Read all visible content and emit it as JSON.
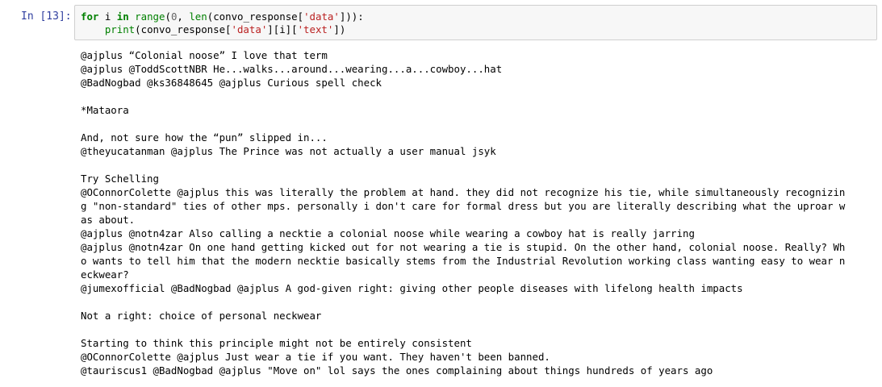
{
  "cell": {
    "prompt": "In [13]:",
    "code_line1": {
      "kw_for": "for",
      "var_i": " i ",
      "kw_in": "in",
      "sp": " ",
      "fn_range": "range",
      "p1": "(",
      "num0": "0",
      "p2": ", ",
      "fn_len": "len",
      "p3": "(convo_response[",
      "str_data": "'data'",
      "p4": "])):"
    },
    "code_line2": {
      "indent": "    ",
      "fn_print": "print",
      "p1": "(convo_response[",
      "str_data": "'data'",
      "p2": "][i][",
      "str_text": "'text'",
      "p3": "])"
    },
    "output_lines": [
      "@ajplus “Colonial noose” I love that term",
      "@ajplus @ToddScottNBR He...walks...around...wearing...a...cowboy...hat",
      "@BadNogbad @ks36848645 @ajplus Curious spell check",
      "",
      "*Mataora",
      "",
      "And, not sure how the “pun” slipped in...",
      "@theyucatanman @ajplus The Prince was not actually a user manual jsyk",
      "",
      "Try Schelling",
      "@OConnorColette @ajplus this was literally the problem at hand. they did not recognize his tie, while simultaneously recognizin",
      "g \"non-standard\" ties of other mps. personally i don't care for formal dress but you are literally describing what the uproar w",
      "as about.",
      "@ajplus @notn4zar Also calling a necktie a colonial noose while wearing a cowboy hat is really jarring",
      "@ajplus @notn4zar On one hand getting kicked out for not wearing a tie is stupid. On the other hand, colonial noose. Really? Wh",
      "o wants to tell him that the modern necktie basically stems from the Industrial Revolution working class wanting easy to wear n",
      "eckwear?",
      "@jumexofficial @BadNogbad @ajplus A god-given right: giving other people diseases with lifelong health impacts",
      "",
      "Not a right: choice of personal neckwear",
      "",
      "Starting to think this principle might not be entirely consistent",
      "@OConnorColette @ajplus Just wear a tie if you want. They haven't been banned.",
      "@tauriscus1 @BadNogbad @ajplus \"Move on\" lol says the ones complaining about things hundreds of years ago"
    ]
  }
}
